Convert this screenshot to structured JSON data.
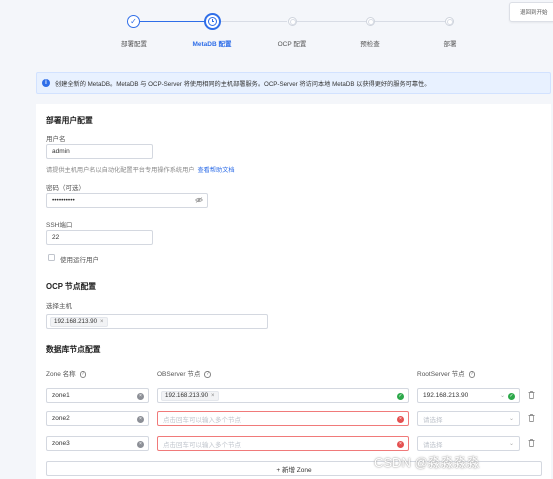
{
  "top_right_button": "退回到开始",
  "steps": [
    {
      "label": "部署配置",
      "status": "done"
    },
    {
      "label": "MetaDB 配置",
      "status": "active"
    },
    {
      "label": "OCP 配置",
      "status": "pending"
    },
    {
      "label": "预检查",
      "status": "pending"
    },
    {
      "label": "部署",
      "status": "pending"
    }
  ],
  "alert": {
    "text": "创建全新的 MetaDB。MetaDB 与 OCP-Server 将使用相同的主机部署服务。OCP-Server 将访问本地 MetaDB 以获得更好的服务可靠性。"
  },
  "deploy_user": {
    "title": "部署用户配置",
    "username_label": "用户名",
    "username_value": "admin",
    "hint_text": "请提供主机用户名以自动化配置平台专用操作系统用户",
    "hint_link": "查看帮助文档",
    "password_label": "密码（可选）",
    "password_value": "••••••••••",
    "ssh_label": "SSH端口",
    "ssh_value": "22",
    "runtime_user_label": "使用运行用户"
  },
  "ocp_node": {
    "title": "OCP 节点配置",
    "host_label": "选择主机",
    "host_tag": "192.168.213.90"
  },
  "db_node": {
    "title": "数据库节点配置",
    "zone_header": "Zone 名称",
    "observer_header": "OBServer 节点",
    "rootserver_header": "RootServer 节点",
    "zones": [
      {
        "name": "zone1",
        "observer_tag": "192.168.213.90",
        "observer_placeholder": "",
        "rootserver": "192.168.213.90",
        "rootserver_placeholder": ""
      },
      {
        "name": "zone2",
        "observer_tag": "",
        "observer_placeholder": "点击回车可以输入多个节点",
        "rootserver": "",
        "rootserver_placeholder": "请选择"
      },
      {
        "name": "zone3",
        "observer_tag": "",
        "observer_placeholder": "点击回车可以输入多个节点",
        "rootserver": "",
        "rootserver_placeholder": "请选择"
      }
    ],
    "add_zone_label": "+ 新增 Zone"
  },
  "watermark": "CSDN @淼淼淼淼"
}
